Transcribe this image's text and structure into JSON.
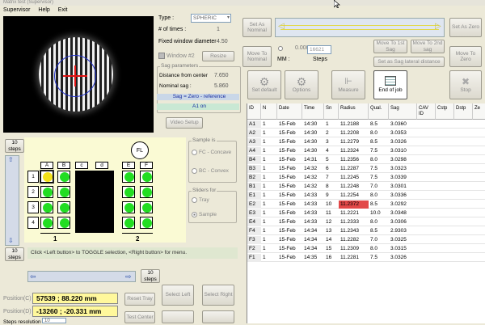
{
  "window": {
    "title": "Matrix test (Supervisor)"
  },
  "menu": [
    "Supervisor",
    "Help",
    "Exit"
  ],
  "params": {
    "type_label": "Type :",
    "type_value": "SPHERIC",
    "times_label": "# of times :",
    "times_value": "1",
    "diameter_label": "Fixed window diameter",
    "diameter_value": "4.50",
    "window_label": "Window #2",
    "resize_label": "Resize",
    "sag_group": "Sag parameters",
    "dist_label": "Distance from center",
    "dist_value": "7.650",
    "nominal_label": "Nominal sag :",
    "nominal_value": "5.860",
    "sag_ref": "Sag = Zero - reference",
    "a1_on": "A1 on",
    "video_setup": "Video Setup"
  },
  "controls": {
    "set_as_nominal": "Set As Nominal",
    "move_to_nominal": "Move To Nominal",
    "pos_value": "0.0000",
    "mm": "MM :",
    "steps_value": "16621",
    "steps_label": "Steps",
    "move_1st_sag": "Move To 1st Sag",
    "move_2nd_sag": "Move To 2nd sag",
    "set_as_zero": "Set As Zero",
    "move_to_zero": "Move To Zero",
    "set_lateral": "Set as Sag lateral distance",
    "set_default": "Set default",
    "options": "Options",
    "measure": "Measure",
    "end_of_job": "End of job",
    "stop": "Stop"
  },
  "tray": {
    "steps_btn": "10 steps",
    "fl": "FL",
    "columns": [
      "A",
      "B",
      "c",
      "d",
      "E",
      "F"
    ],
    "rows": [
      "1",
      "2",
      "3",
      "4"
    ],
    "group1": "1",
    "group2": "2",
    "sample_is": "Sample is",
    "fc_concave": "FC - Concave",
    "bc_convex": "BC - Convex",
    "sliders_for": "Sliders for",
    "opt_tray": "Tray",
    "opt_sample": "Sample",
    "status": "Click <Left button> to TOGGLE selection, <Right button> for menu.",
    "pos_c_label": "Position(C)",
    "pos_c": "57539 ; 88.220 mm",
    "pos_d_label": "Position(D)",
    "pos_d": "-13260 ; -20.331 mm",
    "steps_res_label": "Steps resolution",
    "steps_res_value": "10",
    "reset_tray": "Reset Tray",
    "select_left": "Select Left",
    "select_right": "Select Right",
    "test_center": "Test Center"
  },
  "table": {
    "headers": [
      "ID",
      "N",
      "Date",
      "Time",
      "Sn",
      "Radius",
      "Qual.",
      "Sag",
      "CAV ID",
      "Cstp",
      "Dstp",
      "Ze"
    ],
    "rows": [
      [
        "A1",
        "1",
        "15-Feb",
        "14:30",
        "1",
        "11.2188",
        "8.5",
        "3.0360"
      ],
      [
        "A2",
        "1",
        "15-Feb",
        "14:30",
        "2",
        "11.2208",
        "8.0",
        "3.0353"
      ],
      [
        "A3",
        "1",
        "15-Feb",
        "14:30",
        "3",
        "11.2279",
        "8.5",
        "3.0326"
      ],
      [
        "A4",
        "1",
        "15-Feb",
        "14:30",
        "4",
        "11.2324",
        "7.5",
        "3.0310"
      ],
      [
        "B4",
        "1",
        "15-Feb",
        "14:31",
        "5",
        "11.2356",
        "8.0",
        "3.0298"
      ],
      [
        "B3",
        "1",
        "15-Feb",
        "14:32",
        "6",
        "11.2287",
        "7.5",
        "3.0323"
      ],
      [
        "B2",
        "1",
        "15-Feb",
        "14:32",
        "7",
        "11.2245",
        "7.5",
        "3.0339"
      ],
      [
        "B1",
        "1",
        "15-Feb",
        "14:32",
        "8",
        "11.2248",
        "7.0",
        "3.0301"
      ],
      [
        "E1",
        "1",
        "15-Feb",
        "14:33",
        "9",
        "11.2254",
        "8.0",
        "3.0336"
      ],
      [
        "E2",
        "1",
        "15-Feb",
        "14:33",
        "10",
        "11.2372",
        "8.5",
        "3.0292"
      ],
      [
        "E3",
        "1",
        "15-Feb",
        "14:33",
        "11",
        "11.2221",
        "10.0",
        "3.0348"
      ],
      [
        "E4",
        "1",
        "15-Feb",
        "14:33",
        "12",
        "11.2333",
        "8.0",
        "3.0306"
      ],
      [
        "F4",
        "1",
        "15-Feb",
        "14:34",
        "13",
        "11.2343",
        "8.5",
        "2.9303"
      ],
      [
        "F3",
        "1",
        "15-Feb",
        "14:34",
        "14",
        "11.2282",
        "7.0",
        "3.0325"
      ],
      [
        "F2",
        "1",
        "15-Feb",
        "14:34",
        "15",
        "11.2309",
        "8.0",
        "3.0315"
      ],
      [
        "F1",
        "1",
        "15-Feb",
        "14:35",
        "16",
        "11.2281",
        "7.5",
        "3.0326"
      ]
    ],
    "highlight_row": 9
  },
  "colors": {
    "accent": "#e24848",
    "well": "#22dd22",
    "selected_well": "#f2e01a",
    "tray": "#fafad4"
  }
}
